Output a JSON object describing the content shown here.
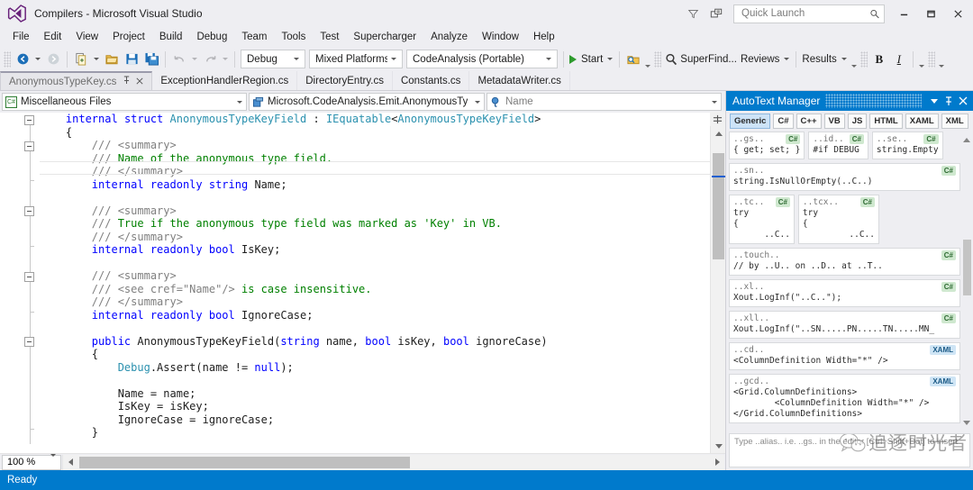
{
  "window": {
    "title": "Compilers - Microsoft Visual Studio",
    "logo_icon": "visual-studio-logo",
    "minimize_label": "–",
    "maximize_label": "❐",
    "close_label": "✕"
  },
  "titlebar_icons": [
    {
      "name": "funnel-icon",
      "glyph": "▽"
    },
    {
      "name": "feedback-icon",
      "glyph": "⧉"
    }
  ],
  "quick_launch": {
    "placeholder": "Quick Launch",
    "value": "",
    "search_icon": "search-icon"
  },
  "menu": {
    "items": [
      "File",
      "Edit",
      "View",
      "Project",
      "Build",
      "Debug",
      "Team",
      "Tools",
      "Test",
      "Supercharger",
      "Analyze",
      "Window",
      "Help"
    ]
  },
  "toolbar": {
    "navigate_back_icon": "navigate-back-icon",
    "navigate_forward_icon": "navigate-forward-icon",
    "new_item_icon": "new-item-icon",
    "open_file_icon": "open-file-icon",
    "save_icon": "save-icon",
    "save_all_icon": "save-all-icon",
    "undo_icon": "undo-icon",
    "redo_icon": "redo-icon",
    "config_value": "Debug",
    "platform_value": "Mixed Platforms",
    "project_value": "CodeAnalysis (Portable)",
    "start_label": "Start",
    "start_icon": "play-icon",
    "find_window_icon": "find-window-icon",
    "superfind_label": "SuperFind...",
    "superfind_icon": "magnifier-icon",
    "reviews_label": "Reviews",
    "results_label": "Results",
    "bold_label": "B",
    "italic_label": "I"
  },
  "doc_tabs": [
    {
      "label": "AnonymousTypeKey.cs",
      "active": true,
      "pin_icon": "pin-icon",
      "close_icon": "close-icon"
    },
    {
      "label": "ExceptionHandlerRegion.cs",
      "active": false
    },
    {
      "label": "DirectoryEntry.cs",
      "active": false
    },
    {
      "label": "Constants.cs",
      "active": false
    },
    {
      "label": "MetadataWriter.cs",
      "active": false
    }
  ],
  "nav_bar": {
    "project": {
      "value": "Miscellaneous Files",
      "icon": "csharp-project-icon"
    },
    "type": {
      "value": "Microsoft.CodeAnalysis.Emit.AnonymousTyp",
      "icon": "struct-icon"
    },
    "member": {
      "value": "Name",
      "icon": "field-icon",
      "is_placeholder": true
    }
  },
  "editor": {
    "zoom_level": "100 %",
    "code_lines": [
      [
        {
          "t": "    ",
          "c": ""
        },
        {
          "t": "internal",
          "c": "kw"
        },
        {
          "t": " ",
          "c": ""
        },
        {
          "t": "struct",
          "c": "kw"
        },
        {
          "t": " ",
          "c": ""
        },
        {
          "t": "AnonymousTypeKeyField",
          "c": "typ"
        },
        {
          "t": " : ",
          "c": ""
        },
        {
          "t": "IEquatable",
          "c": "typ"
        },
        {
          "t": "<",
          "c": ""
        },
        {
          "t": "AnonymousTypeKeyField",
          "c": "typ"
        },
        {
          "t": ">",
          "c": ""
        }
      ],
      [
        {
          "t": "    {",
          "c": ""
        }
      ],
      [
        {
          "t": "        /// ",
          "c": "cmtx"
        },
        {
          "t": "<summary>",
          "c": "cmtx"
        }
      ],
      [
        {
          "t": "        /// ",
          "c": "cmtx"
        },
        {
          "t": "Name of the anonymous type field.",
          "c": "cmt"
        }
      ],
      [
        {
          "t": "        /// ",
          "c": "cmtx"
        },
        {
          "t": "</summary>",
          "c": "cmtx"
        }
      ],
      [
        {
          "t": "        ",
          "c": ""
        },
        {
          "t": "internal",
          "c": "kw"
        },
        {
          "t": " ",
          "c": ""
        },
        {
          "t": "readonly",
          "c": "kw"
        },
        {
          "t": " ",
          "c": ""
        },
        {
          "t": "string",
          "c": "kw"
        },
        {
          "t": " Name;",
          "c": ""
        }
      ],
      [
        {
          "t": "",
          "c": ""
        }
      ],
      [
        {
          "t": "        /// ",
          "c": "cmtx"
        },
        {
          "t": "<summary>",
          "c": "cmtx"
        }
      ],
      [
        {
          "t": "        /// ",
          "c": "cmtx"
        },
        {
          "t": "True if the anonymous type field was marked as 'Key' in VB.",
          "c": "cmt"
        }
      ],
      [
        {
          "t": "        /// ",
          "c": "cmtx"
        },
        {
          "t": "</summary>",
          "c": "cmtx"
        }
      ],
      [
        {
          "t": "        ",
          "c": ""
        },
        {
          "t": "internal",
          "c": "kw"
        },
        {
          "t": " ",
          "c": ""
        },
        {
          "t": "readonly",
          "c": "kw"
        },
        {
          "t": " ",
          "c": ""
        },
        {
          "t": "bool",
          "c": "kw"
        },
        {
          "t": " IsKey;",
          "c": ""
        }
      ],
      [
        {
          "t": "",
          "c": ""
        }
      ],
      [
        {
          "t": "        /// ",
          "c": "cmtx"
        },
        {
          "t": "<summary>",
          "c": "cmtx"
        }
      ],
      [
        {
          "t": "        /// ",
          "c": "cmtx"
        },
        {
          "t": "<see cref=",
          "c": "cmtx"
        },
        {
          "t": "\"Name\"",
          "c": "cmtx"
        },
        {
          "t": "/> ",
          "c": "cmtx"
        },
        {
          "t": "is case insensitive.",
          "c": "cmt"
        }
      ],
      [
        {
          "t": "        /// ",
          "c": "cmtx"
        },
        {
          "t": "</summary>",
          "c": "cmtx"
        }
      ],
      [
        {
          "t": "        ",
          "c": ""
        },
        {
          "t": "internal",
          "c": "kw"
        },
        {
          "t": " ",
          "c": ""
        },
        {
          "t": "readonly",
          "c": "kw"
        },
        {
          "t": " ",
          "c": ""
        },
        {
          "t": "bool",
          "c": "kw"
        },
        {
          "t": " IgnoreCase;",
          "c": ""
        }
      ],
      [
        {
          "t": "",
          "c": ""
        }
      ],
      [
        {
          "t": "        ",
          "c": ""
        },
        {
          "t": "public",
          "c": "kw"
        },
        {
          "t": " AnonymousTypeKeyField(",
          "c": ""
        },
        {
          "t": "string",
          "c": "kw"
        },
        {
          "t": " name, ",
          "c": ""
        },
        {
          "t": "bool",
          "c": "kw"
        },
        {
          "t": " isKey, ",
          "c": ""
        },
        {
          "t": "bool",
          "c": "kw"
        },
        {
          "t": " ignoreCase)",
          "c": ""
        }
      ],
      [
        {
          "t": "        {",
          "c": ""
        }
      ],
      [
        {
          "t": "            ",
          "c": ""
        },
        {
          "t": "Debug",
          "c": "typ"
        },
        {
          "t": ".Assert(name != ",
          "c": ""
        },
        {
          "t": "null",
          "c": "kw"
        },
        {
          "t": ");",
          "c": ""
        }
      ],
      [
        {
          "t": "",
          "c": ""
        }
      ],
      [
        {
          "t": "            Name = name;",
          "c": ""
        }
      ],
      [
        {
          "t": "            IsKey = isKey;",
          "c": ""
        }
      ],
      [
        {
          "t": "            IgnoreCase = ignoreCase;",
          "c": ""
        }
      ],
      [
        {
          "t": "        }",
          "c": ""
        }
      ]
    ]
  },
  "tool_window": {
    "title": "AutoText Manager",
    "dropdown_icon": "chevron-down-icon",
    "pin_icon": "pin-icon",
    "close_icon": "close-icon",
    "language_tabs": [
      {
        "label": "Generic",
        "selected": true
      },
      {
        "label": "C#",
        "selected": false
      },
      {
        "label": "C++",
        "selected": false
      },
      {
        "label": "VB",
        "selected": false
      },
      {
        "label": "JS",
        "selected": false
      },
      {
        "label": "HTML",
        "selected": false
      },
      {
        "label": "XAML",
        "selected": false
      },
      {
        "label": "XML",
        "selected": false
      }
    ],
    "snippets": [
      {
        "alias": "..gs..",
        "lang": "C#",
        "body": "{ get; set; }",
        "full": false
      },
      {
        "alias": "..id..",
        "lang": "C#",
        "body": "#if DEBUG",
        "full": false
      },
      {
        "alias": "..se..",
        "lang": "C#",
        "body": "string.Empty",
        "full": false
      },
      {
        "alias": "..sn..",
        "lang": "C#",
        "body": "string.IsNullOrEmpty(..C..)",
        "full": true
      },
      {
        "alias": "..tc..",
        "lang": "C#",
        "body": "try\n{\n      ..C..",
        "full": false
      },
      {
        "alias": "..tcx..",
        "lang": "C#",
        "body": "try\n{\n         ..C..",
        "full": false
      },
      {
        "alias": "..touch..",
        "lang": "C#",
        "body": "// by ..U.. on ..D.. at ..T..",
        "full": true
      },
      {
        "alias": "..xl..",
        "lang": "C#",
        "body": "Xout.LogInf(\"..C..\");",
        "full": true
      },
      {
        "alias": "..xll..",
        "lang": "C#",
        "body": "Xout.LogInf(\"..SN.....PN.....TN.....MN_",
        "full": true
      },
      {
        "alias": "..cd..",
        "lang": "XAML",
        "body": "<ColumnDefinition Width=\"*\" />",
        "full": true
      },
      {
        "alias": "..gcd..",
        "lang": "XAML",
        "body": "<Grid.ColumnDefinitions>\n        <ColumnDefinition Width=\"*\" />\n</Grid.ColumnDefinitions>",
        "full": true
      }
    ],
    "footer_hint": "Type ..alias.. i.e. ..gs.. in the editor [Ctrl+Shift+Dot] to insert",
    "watermark_text": "追逐时光者",
    "watermark_icon": "wechat-icon"
  },
  "status_bar": {
    "text": "Ready"
  },
  "colors": {
    "accent": "#007acc",
    "chrome": "#eeeef2",
    "keyword": "#0000ff",
    "type": "#2b91af",
    "comment": "#008000",
    "comment_tag": "#808080",
    "start_green": "#2e9b2e"
  }
}
